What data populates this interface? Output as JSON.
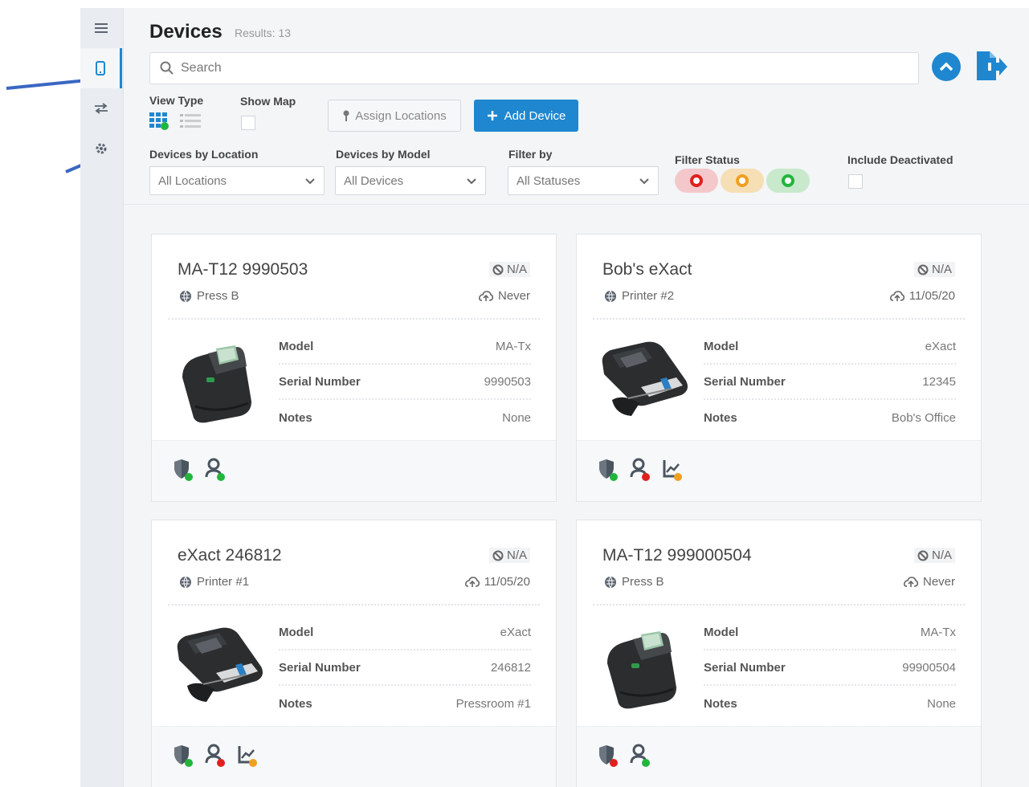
{
  "header": {
    "title": "Devices",
    "results": "Results: 13"
  },
  "search": {
    "placeholder": "Search"
  },
  "controls": {
    "view_type_label": "View Type",
    "show_map_label": "Show Map",
    "assign_locations_label": "Assign Locations",
    "add_device_label": "Add Device"
  },
  "filters": {
    "location": {
      "label": "Devices by Location",
      "value": "All Locations"
    },
    "model": {
      "label": "Devices by Model",
      "value": "All Devices"
    },
    "filter_by": {
      "label": "Filter by",
      "value": "All Statuses"
    },
    "status_label": "Filter Status",
    "include_deactivated_label": "Include Deactivated"
  },
  "colors": {
    "accent": "#1f87d0",
    "red": "#e0201e",
    "orange": "#f0a020",
    "green": "#22b53c"
  },
  "property_labels": {
    "model": "Model",
    "serial": "Serial Number",
    "notes": "Notes"
  },
  "devices": [
    {
      "name": "MA-T12 9990503",
      "status": "N/A",
      "location": "Press B",
      "sync": "Never",
      "model": "MA-Tx",
      "serial": "9990503",
      "notes": "None",
      "image": "ma-tx"
    },
    {
      "name": "Bob's eXact",
      "status": "N/A",
      "location": "Printer #2",
      "sync": "11/05/20",
      "model": "eXact",
      "serial": "12345",
      "notes": "Bob's Office",
      "image": "exact"
    },
    {
      "name": "eXact 246812",
      "status": "N/A",
      "location": "Printer #1",
      "sync": "11/05/20",
      "model": "eXact",
      "serial": "246812",
      "notes": "Pressroom #1",
      "image": "exact"
    },
    {
      "name": "MA-T12 999000504",
      "status": "N/A",
      "location": "Press B",
      "sync": "Never",
      "model": "MA-Tx",
      "serial": "99900504",
      "notes": "None",
      "image": "ma-tx"
    }
  ]
}
